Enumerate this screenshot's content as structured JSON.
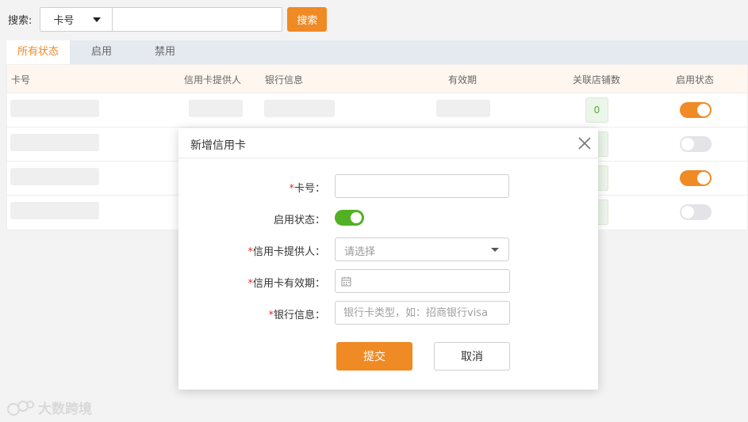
{
  "search": {
    "label": "搜索:",
    "field_select": "卡号",
    "input_value": "",
    "button": "搜索"
  },
  "tabs": [
    {
      "label": "所有状态",
      "active": true
    },
    {
      "label": "启用",
      "active": false
    },
    {
      "label": "禁用",
      "active": false
    }
  ],
  "table": {
    "headers": [
      "卡号",
      "信用卡提供人",
      "银行信息",
      "有效期",
      "关联店铺数",
      "启用状态"
    ],
    "rows": [
      {
        "store_count": "0",
        "enabled": true
      },
      {
        "store_count": "",
        "enabled": false
      },
      {
        "store_count": "",
        "enabled": true
      },
      {
        "store_count": "",
        "enabled": false
      }
    ]
  },
  "modal": {
    "title": "新增信用卡",
    "fields": {
      "card_number": {
        "required_mark": "*",
        "label": "卡号：",
        "value": ""
      },
      "status": {
        "label": "启用状态：",
        "enabled": true
      },
      "provider": {
        "required_mark": "*",
        "label": "信用卡提供人：",
        "placeholder": "请选择"
      },
      "expiry": {
        "required_mark": "*",
        "label": "信用卡有效期：",
        "value": ""
      },
      "bank": {
        "required_mark": "*",
        "label": "银行信息：",
        "placeholder": "银行卡类型，如：招商银行visa"
      }
    },
    "submit_label": "提交",
    "cancel_label": "取消"
  },
  "watermark": "大数跨境",
  "colors": {
    "accent": "#f08a24",
    "toggle_green": "#52b023",
    "required": "#e0312b"
  }
}
